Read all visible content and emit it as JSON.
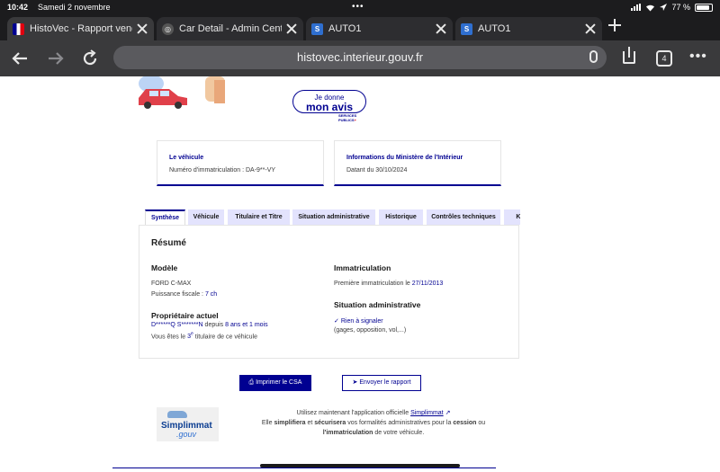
{
  "status_bar": {
    "time": "10:42",
    "date": "Samedi 2 novembre",
    "dots": "•••",
    "battery": "77 %"
  },
  "tabs": [
    {
      "title": "HistoVec - Rapport vendeur",
      "icon": "french-flag-icon"
    },
    {
      "title": "Car Detail - Admin Center",
      "icon": "globe-icon"
    },
    {
      "title": "AUTO1",
      "icon": "auto1-icon"
    },
    {
      "title": "AUTO1",
      "icon": "auto1-icon"
    }
  ],
  "toolbar": {
    "url": "histovec.interieur.gouv.fr",
    "tab_count": "4"
  },
  "header": {
    "avis_line1": "Je donne",
    "avis_line2": "mon avis",
    "services_logo": "SERVICES PUBLICS+"
  },
  "cards": {
    "vehicle": {
      "title": "Le véhicule",
      "text": "Numéro d'immatriculation : DA-9**-VY"
    },
    "ministry": {
      "title": "Informations du Ministère de l'Intérieur",
      "text": "Datant du 30/10/2024"
    }
  },
  "page_tabs": [
    "Synthèse",
    "Véhicule",
    "Titulaire et Titre",
    "Situation administrative",
    "Historique",
    "Contrôles techniques",
    "Kilo"
  ],
  "resume": {
    "title": "Résumé",
    "model_heading": "Modèle",
    "model_value": "FORD C-MAX",
    "power_label": "Puissance fiscale :",
    "power_value": "7 ch",
    "owner_heading": "Propriétaire actuel",
    "owner_name": "D******Q S*******N",
    "owner_since_label": "depuis",
    "owner_since": "8 ans et 1 mois",
    "holder_prefix": "Vous êtes le",
    "holder_rank": "3",
    "holder_rank_suffix": "e",
    "holder_suffix": "titulaire de ce véhicule",
    "immat_heading": "Immatriculation",
    "immat_label": "Première immatriculation le",
    "immat_date": "27/11/2013",
    "admin_heading": "Situation administrative",
    "admin_status": "Rien à signaler",
    "admin_note": "(gages, opposition, vol,...)"
  },
  "actions": {
    "print_label": "Imprimer le CSA",
    "send_label": "Envoyer le rapport"
  },
  "promo": {
    "logo_name": "Simplimmat",
    "logo_sub": ".gouv",
    "line1_pre": "Utilisez maintenant l'application officielle",
    "line1_link": "Simplimmat",
    "line2_a": "Elle",
    "line2_b": "simplifiera",
    "line2_c": "et",
    "line2_d": "sécurisera",
    "line2_e": "vos formalités administratives pour la",
    "line2_f": "cession",
    "line2_g": "ou",
    "line3_a": "l'immatriculation",
    "line3_b": "de votre véhicule."
  }
}
